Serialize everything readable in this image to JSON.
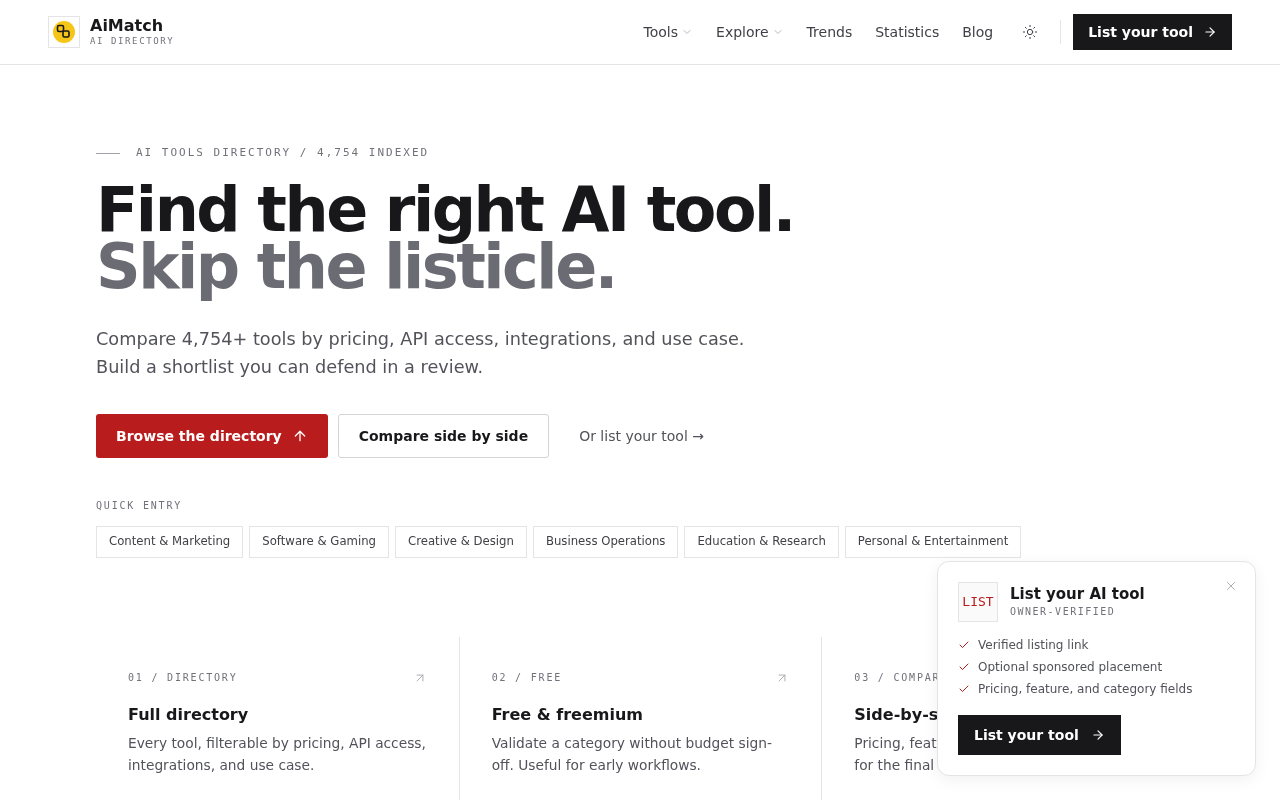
{
  "header": {
    "brand": {
      "name": "AiMatch",
      "tagline": "AI DIRECTORY"
    },
    "nav": [
      {
        "label": "Tools",
        "kind": "dropdown"
      },
      {
        "label": "Explore",
        "kind": "dropdown"
      },
      {
        "label": "Trends",
        "kind": "link"
      },
      {
        "label": "Statistics",
        "kind": "link"
      },
      {
        "label": "Blog",
        "kind": "link"
      }
    ],
    "cta": "List your tool"
  },
  "hero": {
    "eyebrow": "AI TOOLS DIRECTORY / 4,754 INDEXED",
    "headline": "Find the right AI tool.",
    "headline_muted": "Skip the listicle.",
    "subtitle": "Compare 4,754+ tools by pricing, API access, integrations, and use case. Build a shortlist you can defend in a review.",
    "actions": [
      {
        "label": "Browse the directory",
        "kind": "primary"
      },
      {
        "label": "Compare side by side",
        "kind": "secondary"
      },
      {
        "label": "Or list your tool →",
        "kind": "link"
      }
    ]
  },
  "quick_entry": {
    "label": "QUICK ENTRY",
    "chips": [
      "Content & Marketing",
      "Software & Gaming",
      "Creative & Design",
      "Business Operations",
      "Education & Research",
      "Personal & Entertainment"
    ]
  },
  "cards": [
    {
      "kind": "full",
      "label": "01 / DIRECTORY",
      "title": "Full directory",
      "lines": [
        "Every tool, filterable by pricing, API access,",
        "integrations, and use case."
      ]
    },
    {
      "kind": "full",
      "label": "02 / FREE",
      "title": "Free & freemium",
      "lines": [
        "Validate a category without budget sign-",
        "off. Useful for early workflows."
      ]
    },
    {
      "kind": "covered",
      "label": "03 / COMPAR",
      "title": "Side-by-s",
      "lines": [
        "Pricing, feat",
        "for the final"
      ]
    }
  ],
  "popup": {
    "badge": "LIST",
    "title": "List your AI tool",
    "subtitle": "OWNER-VERIFIED",
    "features": [
      "Verified listing link",
      "Optional sponsored placement",
      "Pricing, feature, and category fields"
    ],
    "button": "List your tool"
  }
}
